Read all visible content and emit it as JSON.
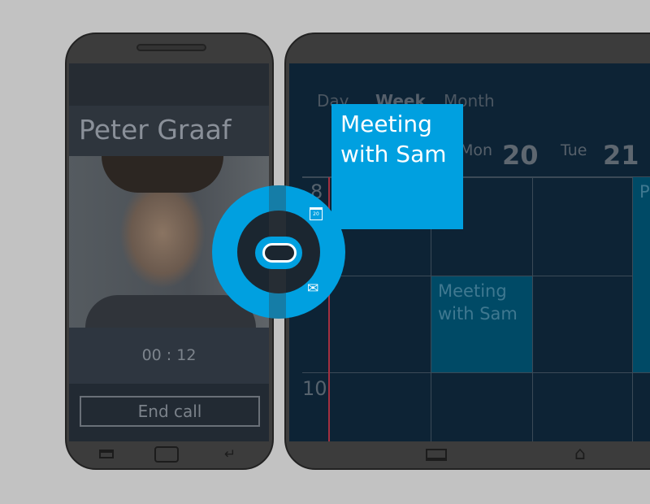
{
  "call": {
    "name": "Peter Graaf",
    "duration": "00 : 12",
    "end_label": "End call"
  },
  "calendar": {
    "tabs": [
      "Day",
      "Week",
      "Month"
    ],
    "days": [
      {
        "name": "Mon",
        "num": "20"
      },
      {
        "name": "Tue",
        "num": "21"
      }
    ],
    "hours": [
      "8",
      "10"
    ],
    "event_title": "Meeting with Sam",
    "partial_event": "P"
  },
  "drag_tile": {
    "title": "Meeting with Sam"
  },
  "radial_menu": {
    "calendar_icon_text": "20"
  },
  "colors": {
    "accent": "#00a0e0",
    "event": "#004a66",
    "now_line": "#a33040"
  }
}
